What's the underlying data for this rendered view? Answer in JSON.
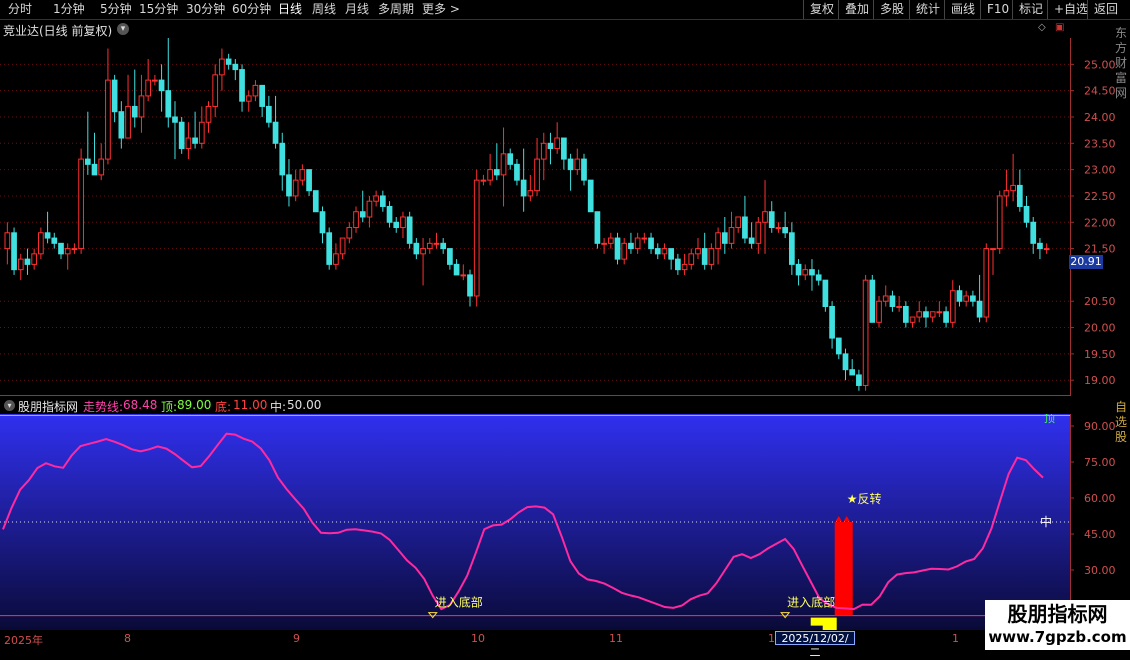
{
  "toolbar": {
    "periods": [
      "分时",
      "1分钟",
      "5分钟",
      "15分钟",
      "30分钟",
      "60分钟",
      "日线",
      "周线",
      "月线",
      "多周期",
      "更多 >"
    ],
    "active": "日线",
    "right_buttons": [
      "复权",
      "叠加",
      "多股",
      "统计",
      "画线",
      "F10",
      "标记",
      "+自选",
      "返回"
    ]
  },
  "main_chart": {
    "title": "竞业达(日线 前复权)",
    "current_price": "20.91",
    "y_ticks": [
      "25.00",
      "24.50",
      "24.00",
      "23.50",
      "23.00",
      "22.50",
      "22.00",
      "21.50",
      "20.50",
      "20.00",
      "19.50",
      "19.00"
    ],
    "y_range": [
      18.7,
      25.5
    ],
    "candles": [
      [
        21.5,
        22.0,
        21.2,
        21.8
      ],
      [
        21.8,
        21.9,
        21.0,
        21.1
      ],
      [
        21.1,
        21.4,
        20.9,
        21.3
      ],
      [
        21.3,
        21.5,
        21.0,
        21.2
      ],
      [
        21.2,
        21.5,
        21.1,
        21.4
      ],
      [
        21.4,
        21.9,
        21.3,
        21.8
      ],
      [
        21.8,
        22.2,
        21.6,
        21.7
      ],
      [
        21.7,
        21.8,
        21.5,
        21.6
      ],
      [
        21.6,
        21.6,
        21.3,
        21.4
      ],
      [
        21.4,
        21.6,
        21.1,
        21.5
      ],
      [
        21.5,
        21.6,
        21.4,
        21.5
      ],
      [
        21.5,
        23.4,
        21.4,
        23.2
      ],
      [
        23.2,
        24.1,
        22.9,
        23.1
      ],
      [
        23.1,
        23.7,
        22.9,
        22.9
      ],
      [
        22.9,
        23.5,
        22.8,
        23.2
      ],
      [
        23.2,
        25.3,
        23.1,
        24.7
      ],
      [
        24.7,
        24.8,
        23.9,
        24.1
      ],
      [
        24.1,
        24.3,
        23.4,
        23.6
      ],
      [
        23.6,
        24.8,
        23.6,
        24.2
      ],
      [
        24.2,
        24.9,
        23.8,
        24.0
      ],
      [
        24.0,
        24.8,
        23.7,
        24.4
      ],
      [
        24.4,
        25.1,
        24.3,
        24.7
      ],
      [
        24.7,
        24.8,
        24.6,
        24.7
      ],
      [
        24.7,
        25.0,
        24.1,
        24.5
      ],
      [
        24.5,
        25.5,
        23.8,
        24.0
      ],
      [
        24.0,
        24.3,
        23.2,
        23.9
      ],
      [
        23.9,
        24.0,
        23.3,
        23.4
      ],
      [
        23.4,
        23.9,
        23.2,
        23.6
      ],
      [
        23.6,
        24.1,
        23.4,
        23.5
      ],
      [
        23.5,
        24.2,
        23.4,
        23.9
      ],
      [
        23.9,
        24.3,
        23.7,
        24.2
      ],
      [
        24.2,
        25.0,
        24.0,
        24.8
      ],
      [
        24.8,
        25.3,
        24.5,
        25.1
      ],
      [
        25.1,
        25.2,
        24.9,
        25.0
      ],
      [
        25.0,
        25.1,
        24.7,
        24.9
      ],
      [
        24.9,
        25.0,
        24.1,
        24.3
      ],
      [
        24.3,
        24.5,
        24.1,
        24.4
      ],
      [
        24.4,
        24.7,
        24.3,
        24.6
      ],
      [
        24.6,
        24.6,
        24.0,
        24.2
      ],
      [
        24.2,
        24.4,
        23.8,
        23.9
      ],
      [
        23.9,
        24.4,
        23.4,
        23.5
      ],
      [
        23.5,
        23.7,
        22.6,
        22.9
      ],
      [
        22.9,
        23.2,
        22.3,
        22.5
      ],
      [
        22.5,
        23.0,
        22.4,
        22.8
      ],
      [
        22.8,
        23.1,
        22.7,
        23.0
      ],
      [
        23.0,
        23.0,
        22.5,
        22.6
      ],
      [
        22.6,
        22.6,
        22.2,
        22.2
      ],
      [
        22.2,
        22.3,
        21.6,
        21.8
      ],
      [
        21.8,
        21.9,
        21.1,
        21.2
      ],
      [
        21.2,
        21.6,
        21.1,
        21.4
      ],
      [
        21.4,
        21.7,
        21.3,
        21.7
      ],
      [
        21.7,
        22.0,
        21.6,
        21.9
      ],
      [
        21.9,
        22.3,
        21.8,
        22.2
      ],
      [
        22.2,
        22.6,
        22.0,
        22.1
      ],
      [
        22.1,
        22.5,
        21.9,
        22.4
      ],
      [
        22.4,
        22.6,
        22.3,
        22.5
      ],
      [
        22.5,
        22.6,
        22.2,
        22.3
      ],
      [
        22.3,
        22.4,
        21.9,
        22.0
      ],
      [
        22.0,
        22.1,
        21.8,
        21.9
      ],
      [
        21.9,
        22.2,
        21.7,
        22.1
      ],
      [
        22.1,
        22.2,
        21.5,
        21.6
      ],
      [
        21.6,
        21.7,
        21.3,
        21.4
      ],
      [
        21.4,
        21.7,
        20.8,
        21.5
      ],
      [
        21.5,
        21.7,
        21.4,
        21.6
      ],
      [
        21.6,
        21.8,
        21.5,
        21.6
      ],
      [
        21.6,
        21.7,
        21.4,
        21.5
      ],
      [
        21.5,
        21.5,
        21.1,
        21.2
      ],
      [
        21.2,
        21.3,
        21.0,
        21.0
      ],
      [
        21.0,
        21.2,
        20.9,
        21.0
      ],
      [
        21.0,
        21.1,
        20.4,
        20.6
      ],
      [
        20.6,
        23.0,
        20.4,
        22.8
      ],
      [
        22.8,
        22.9,
        22.7,
        22.8
      ],
      [
        22.8,
        23.3,
        22.7,
        23.0
      ],
      [
        23.0,
        23.5,
        22.8,
        22.9
      ],
      [
        22.9,
        23.8,
        22.3,
        23.3
      ],
      [
        23.3,
        23.4,
        23.0,
        23.1
      ],
      [
        23.1,
        23.2,
        22.7,
        22.8
      ],
      [
        22.8,
        23.4,
        22.2,
        22.5
      ],
      [
        22.5,
        22.9,
        22.4,
        22.6
      ],
      [
        22.6,
        23.6,
        22.5,
        23.2
      ],
      [
        23.2,
        23.7,
        22.8,
        23.5
      ],
      [
        23.5,
        23.7,
        23.1,
        23.4
      ],
      [
        23.4,
        23.9,
        23.3,
        23.6
      ],
      [
        23.6,
        23.6,
        23.0,
        23.2
      ],
      [
        23.2,
        23.3,
        22.6,
        23.0
      ],
      [
        23.0,
        23.4,
        22.9,
        23.2
      ],
      [
        23.2,
        23.3,
        22.7,
        22.8
      ],
      [
        22.8,
        22.8,
        22.2,
        22.2
      ],
      [
        22.2,
        22.2,
        21.5,
        21.6
      ],
      [
        21.6,
        21.7,
        21.4,
        21.6
      ],
      [
        21.6,
        21.8,
        21.5,
        21.7
      ],
      [
        21.7,
        21.8,
        21.2,
        21.3
      ],
      [
        21.3,
        21.7,
        21.2,
        21.6
      ],
      [
        21.6,
        21.8,
        21.4,
        21.5
      ],
      [
        21.5,
        21.8,
        21.4,
        21.7
      ],
      [
        21.7,
        21.8,
        21.6,
        21.7
      ],
      [
        21.7,
        21.8,
        21.4,
        21.5
      ],
      [
        21.5,
        21.6,
        21.3,
        21.4
      ],
      [
        21.4,
        21.6,
        21.3,
        21.5
      ],
      [
        21.5,
        21.5,
        21.1,
        21.3
      ],
      [
        21.3,
        21.4,
        21.0,
        21.1
      ],
      [
        21.1,
        21.4,
        21.0,
        21.2
      ],
      [
        21.2,
        21.5,
        21.1,
        21.4
      ],
      [
        21.4,
        21.7,
        21.3,
        21.5
      ],
      [
        21.5,
        21.8,
        21.1,
        21.2
      ],
      [
        21.2,
        21.6,
        21.1,
        21.5
      ],
      [
        21.5,
        21.9,
        21.2,
        21.8
      ],
      [
        21.8,
        22.1,
        21.4,
        21.6
      ],
      [
        21.6,
        22.2,
        21.5,
        21.9
      ],
      [
        21.9,
        22.1,
        21.8,
        22.1
      ],
      [
        22.1,
        22.5,
        21.6,
        21.7
      ],
      [
        21.7,
        22.0,
        21.5,
        21.6
      ],
      [
        21.6,
        22.1,
        21.4,
        22.0
      ],
      [
        22.0,
        22.8,
        21.4,
        22.2
      ],
      [
        22.2,
        22.4,
        21.8,
        21.9
      ],
      [
        21.9,
        22.0,
        21.8,
        21.9
      ],
      [
        21.9,
        22.2,
        21.7,
        21.8
      ],
      [
        21.8,
        22.0,
        21.0,
        21.2
      ],
      [
        21.2,
        21.3,
        20.8,
        21.0
      ],
      [
        21.0,
        21.2,
        20.9,
        21.1
      ],
      [
        21.1,
        21.3,
        20.7,
        21.0
      ],
      [
        21.0,
        21.1,
        20.8,
        20.9
      ],
      [
        20.9,
        20.9,
        20.3,
        20.4
      ],
      [
        20.4,
        20.5,
        19.6,
        19.8
      ],
      [
        19.8,
        19.8,
        19.4,
        19.5
      ],
      [
        19.5,
        19.6,
        19.0,
        19.2
      ],
      [
        19.2,
        19.4,
        19.1,
        19.1
      ],
      [
        19.1,
        19.2,
        18.8,
        18.9
      ],
      [
        18.9,
        21.0,
        18.8,
        20.9
      ],
      [
        20.9,
        21.0,
        20.1,
        20.1
      ],
      [
        20.1,
        20.6,
        20.0,
        20.5
      ],
      [
        20.5,
        20.8,
        20.4,
        20.6
      ],
      [
        20.6,
        20.7,
        20.3,
        20.4
      ],
      [
        20.4,
        20.6,
        20.3,
        20.4
      ],
      [
        20.4,
        20.5,
        20.0,
        20.1
      ],
      [
        20.1,
        20.2,
        20.0,
        20.2
      ],
      [
        20.2,
        20.5,
        20.1,
        20.3
      ],
      [
        20.3,
        20.4,
        20.0,
        20.2
      ],
      [
        20.2,
        20.3,
        20.1,
        20.3
      ],
      [
        20.3,
        20.5,
        20.2,
        20.3
      ],
      [
        20.3,
        20.4,
        20.0,
        20.1
      ],
      [
        20.1,
        20.9,
        20.0,
        20.7
      ],
      [
        20.7,
        20.8,
        20.4,
        20.5
      ],
      [
        20.5,
        20.7,
        20.4,
        20.6
      ],
      [
        20.6,
        20.7,
        20.4,
        20.5
      ],
      [
        20.5,
        21.0,
        20.1,
        20.2
      ],
      [
        20.2,
        21.6,
        20.1,
        21.5
      ],
      [
        21.5,
        21.5,
        21.0,
        21.5
      ],
      [
        21.5,
        22.6,
        21.4,
        22.5
      ],
      [
        22.5,
        23.0,
        22.3,
        22.6
      ],
      [
        22.6,
        23.3,
        22.4,
        22.7
      ],
      [
        22.7,
        23.0,
        22.2,
        22.3
      ],
      [
        22.3,
        22.5,
        21.9,
        22.0
      ],
      [
        22.0,
        22.1,
        21.4,
        21.6
      ],
      [
        21.6,
        21.7,
        21.3,
        21.5
      ],
      [
        21.5,
        21.6,
        21.4,
        21.5
      ]
    ]
  },
  "indicator": {
    "name": "股朋指标网",
    "trend_label": "走势线:",
    "trend_value": "68.48",
    "top_label": "顶:",
    "top_value": "89.00",
    "bottom_label": "底:",
    "bottom_value": "11.00",
    "mid_label": "中:",
    "mid_value": "50.00",
    "y_ticks": [
      "90.00",
      "75.00",
      "60.00",
      "45.00",
      "30.00",
      "15.00"
    ],
    "y_range": [
      5,
      95
    ],
    "line_values": [
      46.9,
      55.9,
      63.5,
      67.4,
      72.5,
      74.5,
      73.2,
      72.6,
      77.8,
      81.6,
      82.6,
      83.5,
      84.6,
      83.4,
      82.0,
      80.3,
      79.4,
      80.3,
      81.5,
      80.6,
      78.3,
      75.5,
      72.8,
      73.3,
      77.5,
      82.2,
      86.8,
      86.4,
      84.7,
      83.5,
      80.6,
      75.7,
      68.5,
      63.7,
      59.5,
      55.5,
      49.7,
      45.5,
      45.3,
      45.5,
      46.8,
      47.0,
      46.5,
      46.0,
      45.2,
      42.5,
      38.3,
      34.0,
      30.9,
      26.3,
      19.2,
      13.7,
      15.4,
      21.0,
      27.6,
      37.0,
      47.0,
      48.6,
      48.9,
      51.1,
      54.0,
      56.2,
      56.5,
      56.0,
      53.2,
      43.9,
      33.7,
      28.5,
      26.1,
      25.4,
      24.3,
      22.5,
      20.5,
      19.4,
      18.6,
      17.2,
      15.9,
      14.6,
      14.2,
      15.2,
      17.8,
      19.3,
      20.3,
      24.5,
      30.0,
      35.5,
      36.6,
      35.0,
      36.6,
      39.0,
      41.0,
      42.9,
      38.7,
      31.8,
      25.0,
      18.2,
      15.7,
      14.2,
      14.0,
      13.7,
      15.6,
      15.5,
      19.0,
      24.9,
      28.1,
      28.7,
      29.0,
      29.8,
      30.5,
      30.4,
      30.2,
      31.5,
      33.5,
      34.6,
      39.0,
      47.2,
      58.7,
      70.0,
      76.8,
      75.8,
      71.9,
      68.5
    ],
    "events": [
      {
        "label": "进入底部",
        "index": 50
      },
      {
        "label": "进入底部",
        "index": 91
      },
      {
        "label": "★反转",
        "index": 97
      }
    ],
    "mid_text": "中",
    "top_corner_text": "顶"
  },
  "date_axis": {
    "labels": [
      "2025年",
      "8",
      "9",
      "10",
      "11",
      "1",
      "1"
    ],
    "cursor": "2025/12/02/二"
  },
  "right_strip_top": "东方财富网",
  "right_strip_bottom": "自选股",
  "watermark": {
    "title": "股朋指标网",
    "url": "www.7gpzb.com"
  },
  "colors": {
    "up": "#ff3030",
    "down": "#40e0e0",
    "trend_line": "#ff2aa0",
    "panel_top": "#3030f0",
    "panel_bottom": "#0a0a38",
    "bottom_line": "#ff3050",
    "signal_bar": "#ff0000",
    "bottom_marker": "#ffff00",
    "axis_label": "#d05050"
  }
}
